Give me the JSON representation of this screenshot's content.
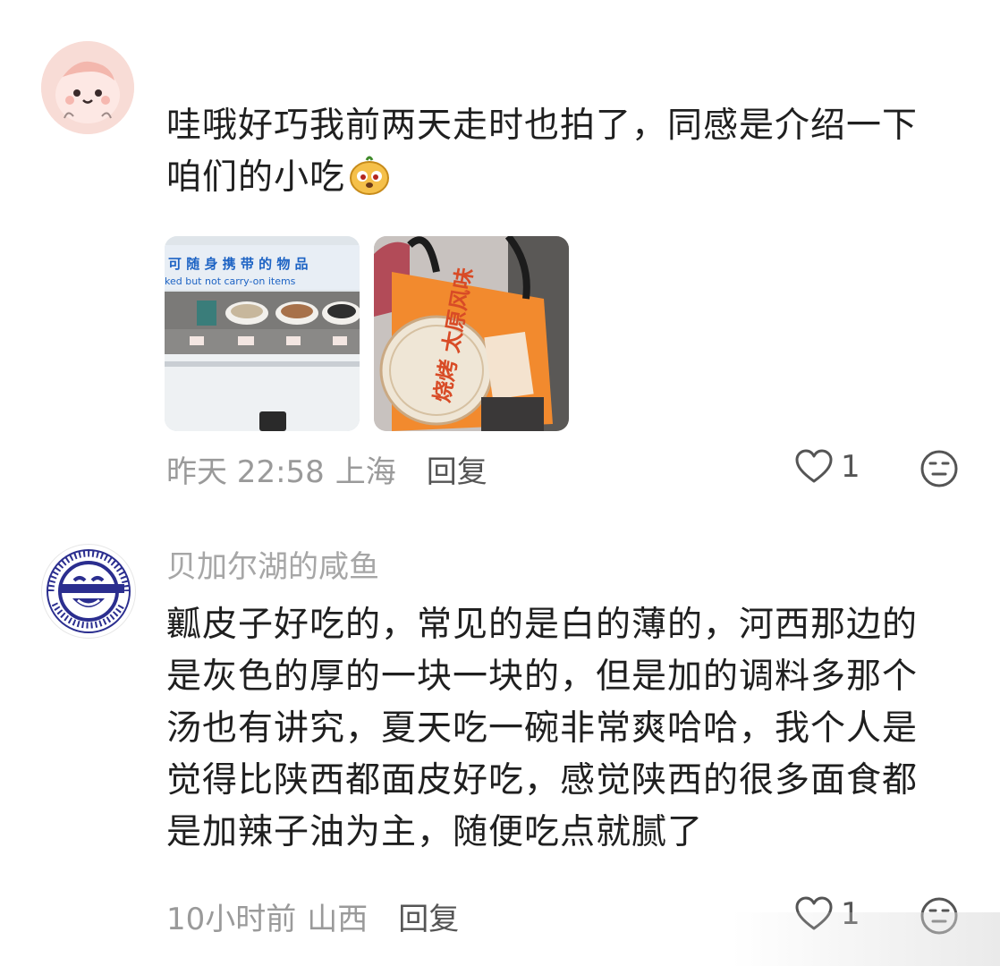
{
  "comments": [
    {
      "text": "哇哦好巧我前两天走时也拍了，同感是介绍一下\n咱们的小吃",
      "photos": [
        {
          "sign_line1": "可 随 身 携 带 的 物 品",
          "sign_line2": "ked but not carry-on items"
        },
        {
          "bowl_text": "烧烤 太原风味"
        }
      ],
      "time": "昨天 22:58",
      "location": "上海",
      "reply_label": "回复",
      "like_count": "1"
    },
    {
      "username": "贝加尔湖的咸鱼",
      "avatar_ring_text": "I thought what I'd do was, I'd pretend I was one of those deaf-mutes",
      "text": "瓤皮子好吃的，常见的是白的薄的，河西那边的\n是灰色的厚的一块一块的，但是加的调料多那个\n汤也有讲究，夏天吃一碗非常爽哈哈，我个人是\n觉得比陕西都面皮好吃，感觉陕西的很多面食都\n是加辣子油为主，随便吃点就腻了",
      "time": "10小时前",
      "location": "山西",
      "reply_label": "回复",
      "like_count": "1"
    }
  ],
  "colors": {
    "meta": "#9a9a9a",
    "username": "#a6a6a6",
    "text": "#1f1f1f",
    "avatar_bg": "#f6d4cf"
  },
  "icons": [
    "heart-outline-icon",
    "emoji-face-icon",
    "inline-dog-emoji"
  ]
}
